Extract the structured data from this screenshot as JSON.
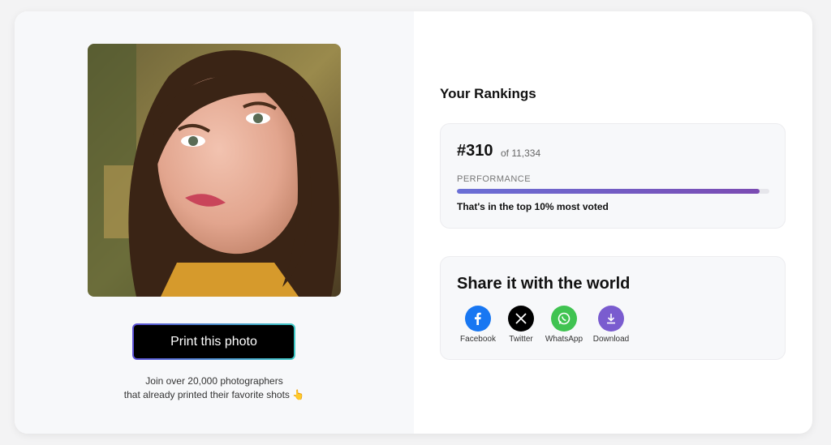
{
  "print": {
    "label": "Print this photo"
  },
  "join": {
    "line1": "Join over 20,000 photographers",
    "line2": "that already printed their favorite shots 👆"
  },
  "rankings": {
    "title": "Your Rankings",
    "rank": "#310",
    "of_total": "of 11,334",
    "performance_label": "PERFORMANCE",
    "performance_fraction": 0.97,
    "performance_text": "That's in the top 10% most voted"
  },
  "share": {
    "title": "Share it with the world",
    "items": [
      {
        "label": "Facebook",
        "icon": "facebook-icon",
        "color": "#1877f2"
      },
      {
        "label": "Twitter",
        "icon": "x-icon",
        "color": "#000000"
      },
      {
        "label": "WhatsApp",
        "icon": "whatsapp-icon",
        "color": "#40c351"
      },
      {
        "label": "Download",
        "icon": "download-icon",
        "color": "#7a5ccf"
      }
    ]
  },
  "colors": {
    "accent_gradient_start": "#5b4fd6",
    "accent_gradient_end": "#3ec9c6",
    "progress_start": "#6a6fd6",
    "progress_end": "#7b4bb2"
  }
}
